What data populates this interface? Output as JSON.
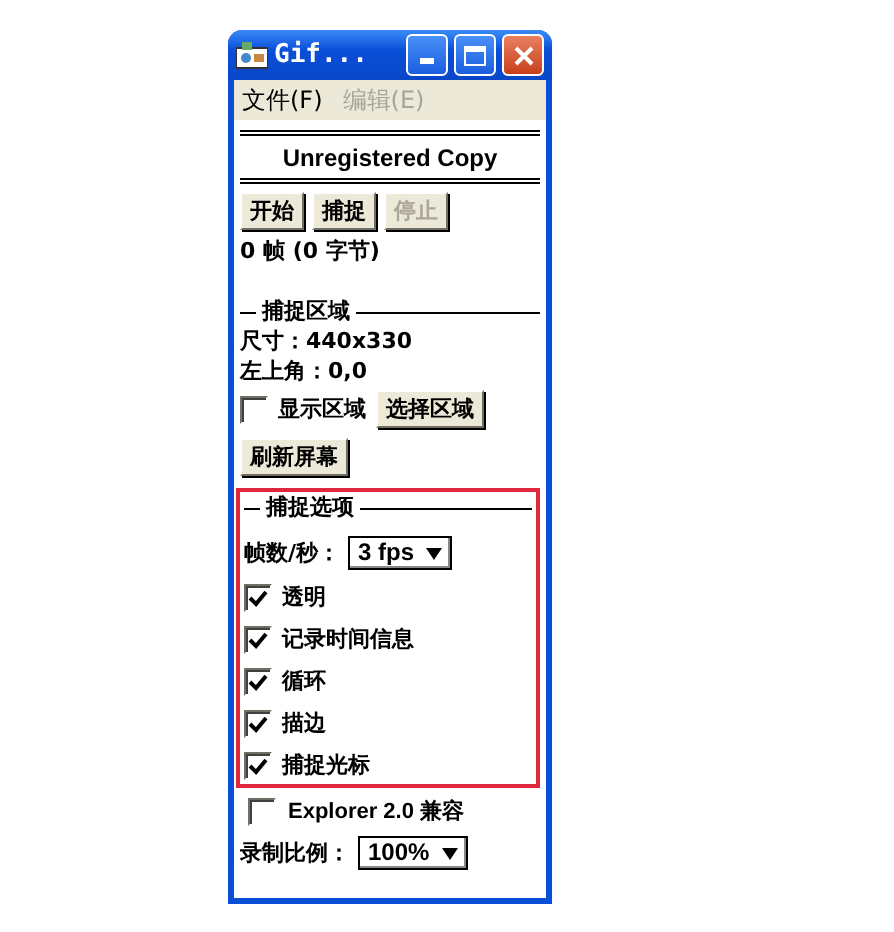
{
  "window": {
    "title": "Gif..."
  },
  "menu": [
    {
      "label": "文件(F)",
      "disabled": false
    },
    {
      "label": "编辑(E)",
      "disabled": true
    }
  ],
  "banner": "Unregistered Copy",
  "buttons": [
    {
      "label": "开始",
      "disabled": false
    },
    {
      "label": "捕捉",
      "disabled": false
    },
    {
      "label": "停止",
      "disabled": true
    }
  ],
  "frame_count": "0 帧 (0 字节)",
  "capture_area": {
    "title": "捕捉区域",
    "size": "尺寸：440x330",
    "top_left": "左上角：0,0",
    "show_area": {
      "label": "显示区域",
      "checked": false
    },
    "select_button": "选择区域",
    "refresh_button": "刷新屏幕"
  },
  "capture_options": {
    "title": "捕捉选项",
    "fps_label": "帧数/秒：",
    "fps_value": "3 fps",
    "options": [
      {
        "label": "透明",
        "checked": true
      },
      {
        "label": "记录时间信息",
        "checked": true
      },
      {
        "label": "循环",
        "checked": true
      },
      {
        "label": "描边",
        "checked": true
      },
      {
        "label": "捕捉光标",
        "checked": true
      }
    ]
  },
  "explorer_compat": {
    "label": "Explorer 2.0 兼容",
    "checked": false
  },
  "scale": {
    "label": "录制比例：",
    "value": "100%"
  }
}
